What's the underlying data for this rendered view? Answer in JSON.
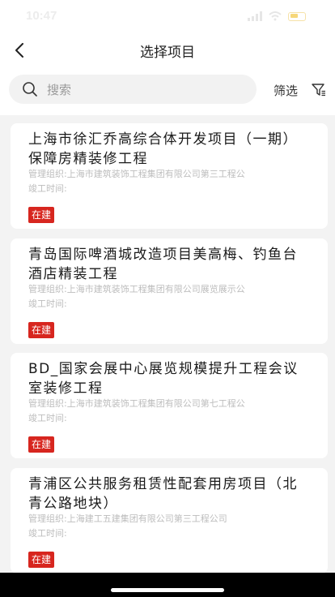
{
  "status_bar": {
    "time": "10:47"
  },
  "header": {
    "title": "选择项目"
  },
  "search": {
    "placeholder": "搜索",
    "filter_label": "筛选"
  },
  "projects": [
    {
      "title": "上海市徐汇乔高综合体开发项目（一期）保障房精装修工程",
      "org": "管理组织:上海市建筑装饰工程集团有限公司第三工程公",
      "date_label": "竣工时间:",
      "status": "在建"
    },
    {
      "title": "青岛国际啤酒城改造项目美高梅、钓鱼台酒店精装工程",
      "org": "管理组织:上海市建筑装饰工程集团有限公司展览展示公",
      "date_label": "竣工时间:",
      "status": "在建"
    },
    {
      "title": "BD_国家会展中心展览规模提升工程会议室装修工程",
      "org": "管理组织:上海市建筑装饰工程集团有限公司第七工程公",
      "date_label": "竣工时间:",
      "status": "在建"
    },
    {
      "title": "青浦区公共服务租赁性配套用房项目（北青公路地块）",
      "org": "管理组织:上海建工五建集团有限公司第三工程公司",
      "date_label": "竣工时间:",
      "status": "在建"
    }
  ]
}
